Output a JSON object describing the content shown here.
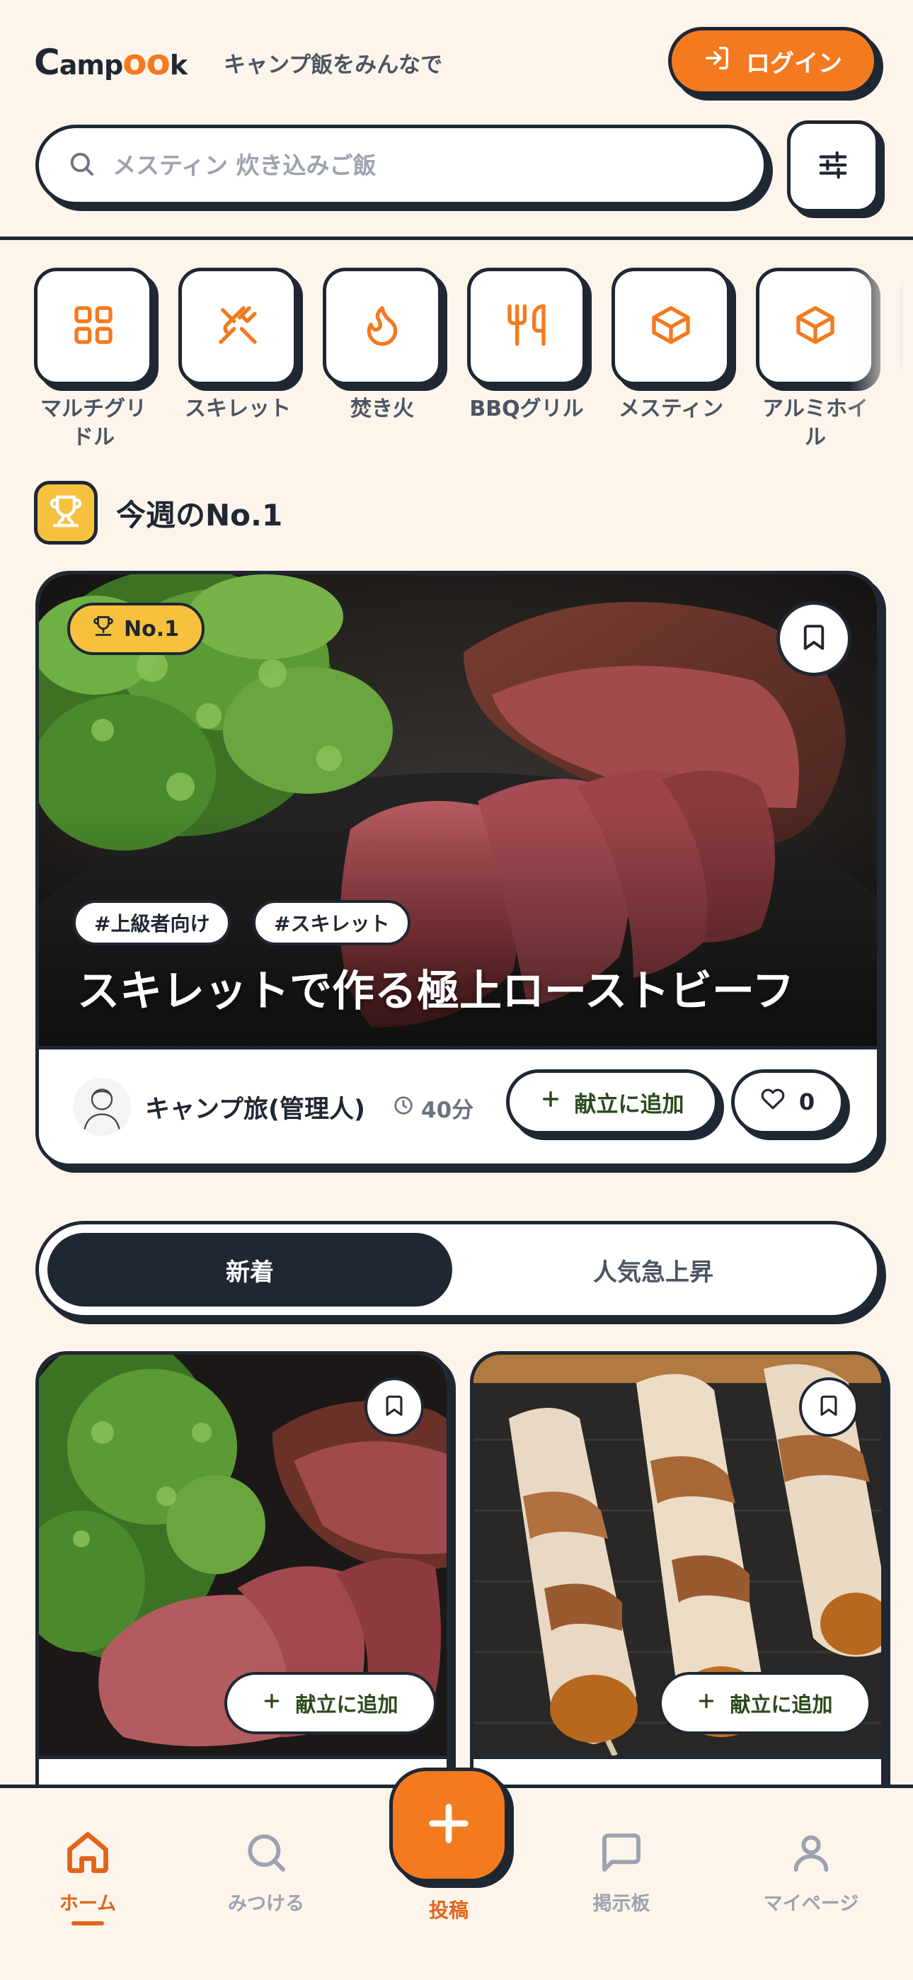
{
  "app": {
    "logo_text": "Campook",
    "tagline": "キャンプ飯をみんなで",
    "brand_color": "#f47a1f",
    "dark_color": "#1f2733"
  },
  "header": {
    "login_label": "ログイン",
    "search": {
      "value": "",
      "placeholder": "メスティン 炊き込みご飯"
    }
  },
  "categories": [
    {
      "label": "マルチグリドル",
      "icon": "grid-icon"
    },
    {
      "label": "スキレット",
      "icon": "utensils-crossed-icon"
    },
    {
      "label": "焚き火",
      "icon": "flame-icon"
    },
    {
      "label": "BBQグリル",
      "icon": "fork-knife-icon"
    },
    {
      "label": "メスティン",
      "icon": "box-icon"
    },
    {
      "label": "アルミホイル",
      "icon": "box-icon"
    }
  ],
  "weekly": {
    "title": "今週のNo.1",
    "badge": "No.1",
    "tags": [
      "#上級者向け",
      "#スキレット"
    ],
    "recipe_title": "スキレットで作る極上ローストビーフ",
    "author": "キャンプ旅(管理人)",
    "time": "40分",
    "add_menu_label": "献立に追加",
    "likes": "0"
  },
  "sort_tabs": {
    "new": "新着",
    "trending": "人気急上昇"
  },
  "grid": [
    {
      "add_menu_label": "献立に追加",
      "image": "roast-beef"
    },
    {
      "add_menu_label": "献立に追加",
      "image": "bacon-skewers"
    }
  ],
  "nav": {
    "home": "ホーム",
    "search": "みつける",
    "post": "投稿",
    "board": "掲示板",
    "mypage": "マイページ"
  }
}
